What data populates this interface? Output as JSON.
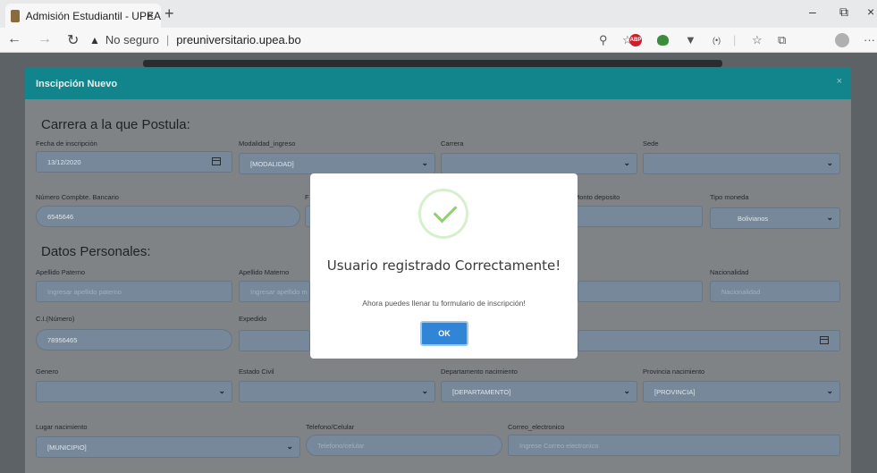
{
  "browser": {
    "tab_title": "Admisión Estudiantil - UPEA",
    "tab_close": "×",
    "new_tab": "+",
    "security_label": "No seguro",
    "url": "preuniversitario.upea.bo",
    "minimize": "–",
    "restore": "⧉",
    "close": "×",
    "back": "←",
    "forward": "→",
    "reload": "↻",
    "abp": "ABP",
    "more": "···"
  },
  "modal": {
    "title": "Inscipción Nuevo",
    "close": "×"
  },
  "form": {
    "section_career": "Carrera a la que Postula:",
    "fecha_label": "Fecha de inscripción",
    "fecha_value": "13/12/2020",
    "modalidad_label": "Modalidad_ingreso",
    "modalidad_value": "[MODALIDAD]",
    "carrera_label": "Carrera",
    "sede_label": "Sede",
    "compbte_label": "Número Compbte. Bancario",
    "compbte_value": "6545646",
    "f_label_partial": "F",
    "monto_label": "Monto deposito",
    "moneda_label": "Tipo moneda",
    "moneda_value": "Bolivianos",
    "section_personal": "Datos Personales:",
    "ap_paterno_label": "Apellido Paterno",
    "ap_paterno_ph": "Ingresar apellido paterno",
    "ap_materno_label": "Apellido Materno",
    "ap_materno_ph": "Ingresar apellido m",
    "nacionalidad_label": "Nacionalidad",
    "nacionalidad_ph": "Nacionalidad",
    "ci_label": "C.I.(Número)",
    "ci_value": "78956465",
    "expedido_label": "Expedido",
    "genero_label": "Genero",
    "estado_label": "Estado Civil",
    "depto_label": "Departamento nacimiento",
    "depto_value": "[DEPARTAMENTO]",
    "provincia_label": "Provincia nacimiento",
    "provincia_value": "[PROVINCIA]",
    "lugar_label": "Lugar nacimiento",
    "lugar_value": "[MUNICIPIO]",
    "telefono_label": "Telefono/Celular",
    "telefono_ph": "Telefono/celular",
    "correo_label": "Correo_electronico",
    "correo_ph": "Ingrese Correo electronico"
  },
  "alert": {
    "title": "Usuario registrado Correctamente!",
    "text": "Ahora puedes llenar tu formulario de inscripción!",
    "ok_label": "OK",
    "icon": "success-check-icon"
  },
  "colors": {
    "header_teal": "#12858c",
    "ok_blue": "#3085d6",
    "success_green": "#8fcf6d"
  }
}
